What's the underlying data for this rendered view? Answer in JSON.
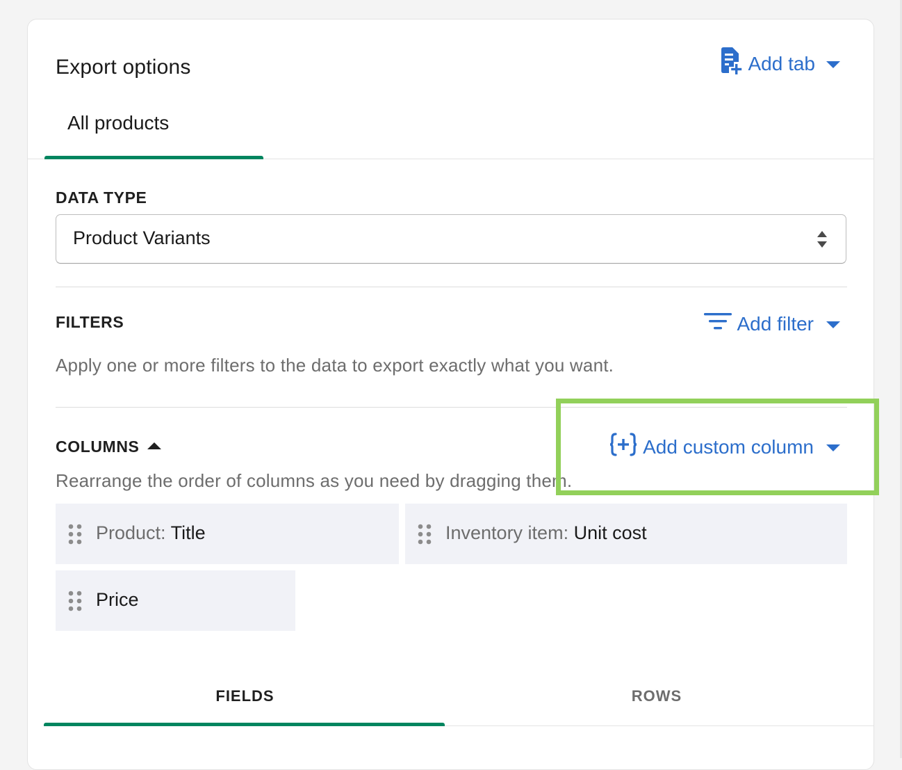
{
  "panel": {
    "title": "Export options",
    "add_tab_label": "Add tab"
  },
  "tabs": [
    {
      "label": "All products",
      "active": true
    }
  ],
  "data_type": {
    "label": "DATA TYPE",
    "selected": "Product Variants"
  },
  "filters": {
    "label": "FILTERS",
    "add_filter_label": "Add filter",
    "help": "Apply one or more filters to the data to export exactly what you want."
  },
  "columns": {
    "label": "COLUMNS",
    "add_custom_label": "Add custom column",
    "help": "Rearrange the order of columns as you need by dragging them.",
    "items": [
      {
        "prefix": "Product: ",
        "name": "Title"
      },
      {
        "prefix": "Inventory item: ",
        "name": "Unit cost"
      },
      {
        "prefix": "",
        "name": "Price"
      }
    ]
  },
  "bottom_tabs": [
    {
      "label": "FIELDS",
      "active": true
    },
    {
      "label": "ROWS",
      "active": false
    }
  ],
  "colors": {
    "accent_link": "#2c6ecb",
    "active_tab": "#00855f",
    "highlight": "#92d05a",
    "chip_bg": "#f1f2f7"
  },
  "icons": {
    "add_tab": "document-plus-icon",
    "add_filter": "filter-lines-icon",
    "add_custom": "curly-brace-plus-icon",
    "grip": "drag-handle-icon",
    "select": "select-arrows-icon"
  }
}
